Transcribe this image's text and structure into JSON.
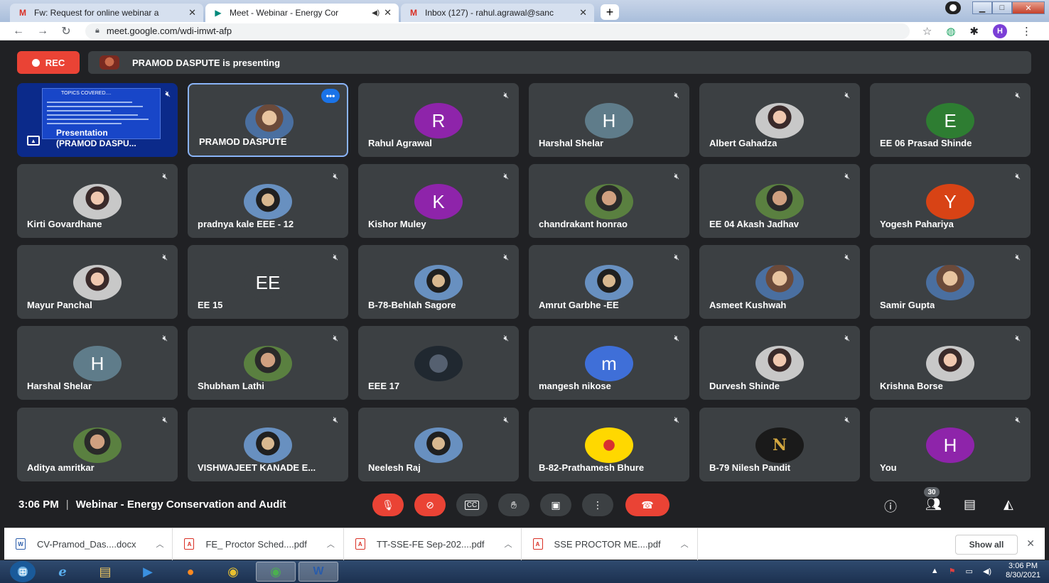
{
  "browser": {
    "tabs": [
      {
        "label": "Fw: Request for online webinar a",
        "favicon": "gmail-icon",
        "active": false
      },
      {
        "label": "Meet - Webinar - Energy Cor",
        "favicon": "meet-icon",
        "active": true
      },
      {
        "label": "Inbox (127) - rahul.agrawal@sanc",
        "favicon": "gmail-icon",
        "active": false
      }
    ],
    "url": "meet.google.com/wdi-imwt-afp",
    "profile_initial": "H"
  },
  "meet": {
    "rec_label": "REC",
    "presenting_text": "PRAMOD DASPUTE is presenting",
    "share_tile": {
      "slide_title": "TOPICS COVERED....",
      "label_line1": "Presentation",
      "label_line2": "(PRAMOD DASPU..."
    },
    "tiles": [
      {
        "name": "PRAMOD DASPUTE",
        "avatar": "photo",
        "highlight": true
      },
      {
        "name": "Rahul Agrawal",
        "avatar": "letter",
        "initial": "R",
        "color": "#8e24aa"
      },
      {
        "name": "Harshal Shelar",
        "avatar": "letter",
        "initial": "H",
        "color": "#5f7c8a"
      },
      {
        "name": "Albert Gahadza",
        "avatar": "photo2"
      },
      {
        "name": "EE 06 Prasad Shinde",
        "avatar": "letter",
        "initial": "E",
        "color": "#2e7d32"
      },
      {
        "name": "Kirti Govardhane",
        "avatar": "photo2"
      },
      {
        "name": "pradnya kale EEE - 12",
        "avatar": "photo4"
      },
      {
        "name": "Kishor Muley",
        "avatar": "letter",
        "initial": "K",
        "color": "#8e24aa"
      },
      {
        "name": "chandrakant honrao",
        "avatar": "photo3"
      },
      {
        "name": "EE 04 Akash Jadhav",
        "avatar": "photo3"
      },
      {
        "name": "Yogesh Pahariya",
        "avatar": "letter",
        "initial": "Y",
        "color": "#d84315"
      },
      {
        "name": "Mayur Panchal",
        "avatar": "photo2"
      },
      {
        "name": "EE 15",
        "avatar": "letter",
        "initial": "EE",
        "color": "#3c4043"
      },
      {
        "name": "B-78-Behlah Sagore",
        "avatar": "photo4"
      },
      {
        "name": "Amrut Garbhe -EE",
        "avatar": "photo4"
      },
      {
        "name": "Asmeet Kushwah",
        "avatar": "photo"
      },
      {
        "name": "Samir Gupta",
        "avatar": "photo"
      },
      {
        "name": "Harshal Shelar",
        "avatar": "letter",
        "initial": "H",
        "color": "#5f7c8a"
      },
      {
        "name": "Shubham Lathi",
        "avatar": "photo3"
      },
      {
        "name": "EEE 17",
        "avatar": "dark"
      },
      {
        "name": "mangesh nikose",
        "avatar": "letter",
        "initial": "m",
        "color": "#3f6fd8"
      },
      {
        "name": "Durvesh Shinde",
        "avatar": "photo2"
      },
      {
        "name": "Krishna Borse",
        "avatar": "photo2"
      },
      {
        "name": "Aditya amritkar",
        "avatar": "photo3"
      },
      {
        "name": "VISHWAJEET KANADE E...",
        "avatar": "photo4"
      },
      {
        "name": "Neelesh Raj",
        "avatar": "photo4"
      },
      {
        "name": "B-82-Prathamesh Bhure",
        "avatar": "yellow"
      },
      {
        "name": "B-79 Nilesh Pandit",
        "avatar": "logo",
        "initial": "N"
      },
      {
        "name": "You",
        "avatar": "letter",
        "initial": "H",
        "color": "#8e24aa"
      }
    ],
    "footer": {
      "time": "3:06 PM",
      "meeting_title": "Webinar - Energy Conservation and Audit",
      "participant_count": "30"
    }
  },
  "downloads": {
    "items": [
      {
        "name": "CV-Pramod_Das....docx",
        "type": "doc"
      },
      {
        "name": "FE_ Proctor Sched....pdf",
        "type": "pdf"
      },
      {
        "name": "TT-SSE-FE Sep-202....pdf",
        "type": "pdf"
      },
      {
        "name": "SSE PROCTOR ME....pdf",
        "type": "pdf"
      }
    ],
    "show_all_label": "Show all"
  },
  "taskbar": {
    "time": "3:06 PM",
    "date": "8/30/2021"
  }
}
